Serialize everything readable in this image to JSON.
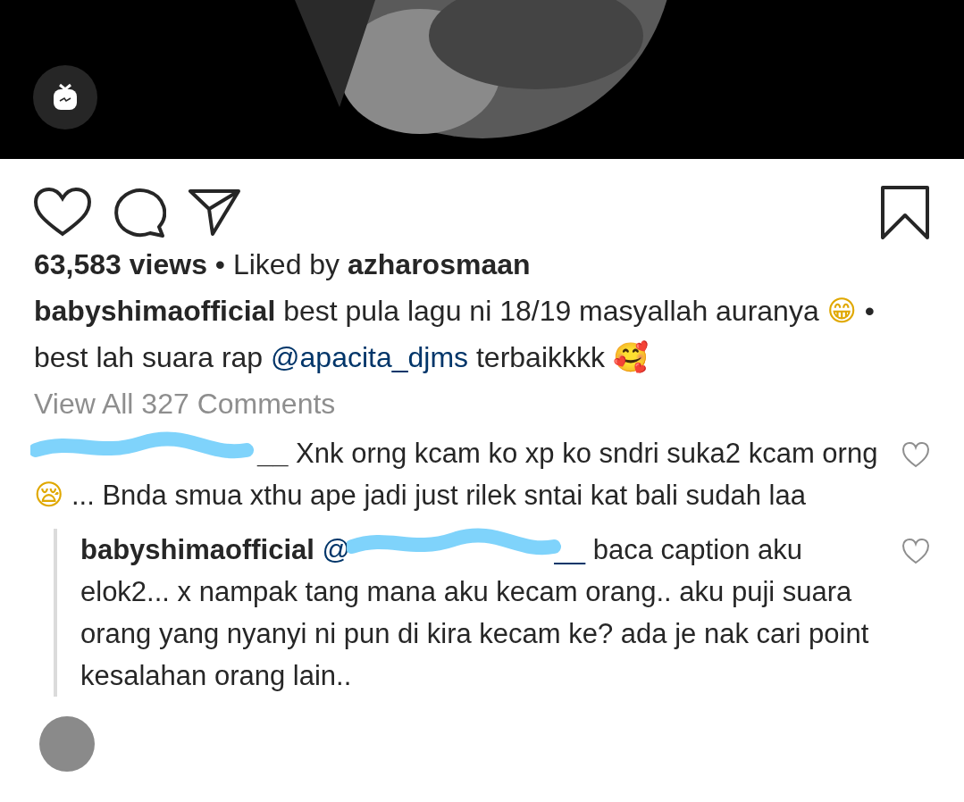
{
  "post": {
    "views": "63,583 views",
    "separator": "•",
    "liked_by_label": "Liked by",
    "liked_by": "azharosmaan",
    "caption": {
      "username": "babyshimaofficial",
      "parts": [
        {
          "kind": "text",
          "text": "best pula lagu ni 18/19 masyallah auranya"
        },
        {
          "kind": "emoji",
          "text": "😁"
        },
        {
          "kind": "text",
          "text": "• best lah suara rap"
        },
        {
          "kind": "mention",
          "text": "@apacita_djms"
        },
        {
          "kind": "text",
          "text": "terbaikkkk"
        },
        {
          "kind": "emoji",
          "text": "🥰"
        }
      ]
    },
    "view_all": "View All 327 Comments"
  },
  "comments": [
    {
      "username": "__",
      "redacted": true,
      "liked": false,
      "parts": [
        {
          "kind": "text",
          "text": "Xnk orng kcam ko xp ko sndri suka2 kcam orng"
        },
        {
          "kind": "emoji",
          "text": "😪"
        },
        {
          "kind": "text",
          "text": "... Bnda smua xthu ape jadi just rilek sntai kat bali sudah laa"
        }
      ],
      "replies": [
        {
          "username": "babyshimaofficial",
          "redacted": false,
          "liked": false,
          "parts": [
            {
              "kind": "mention",
              "text": "@",
              "redacted_after": true
            },
            {
              "kind": "mention",
              "text": "__"
            },
            {
              "kind": "text",
              "text": "baca caption aku elok2... x nampak tang mana aku kecam orang.. aku puji suara orang yang nyanyi ni pun di kira kecam ke? ada je nak cari point kesalahan orang lain.."
            }
          ]
        }
      ]
    }
  ]
}
